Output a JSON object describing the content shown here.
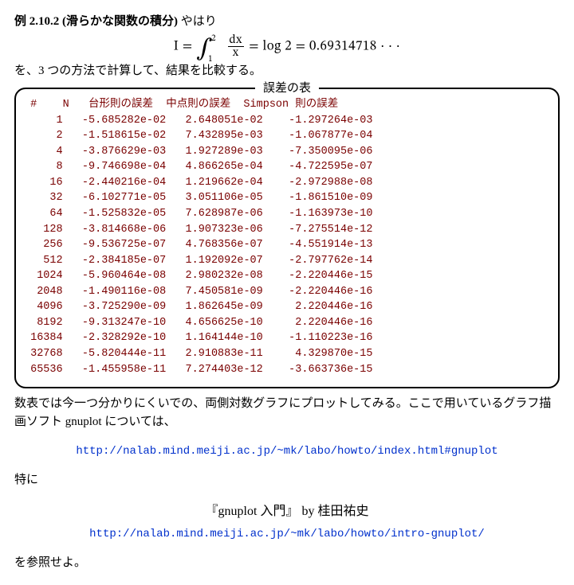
{
  "header": {
    "example_label": "例 2.10.2 (滑らかな関数の積分)",
    "after_label": " やはり",
    "equation_lhs": "I =",
    "integral_symbol": "∫",
    "int_lower": "1",
    "int_upper": "2",
    "frac_num": "dx",
    "frac_den": "x",
    "equation_rhs": " = log 2 = 0.69314718 · · ·",
    "line2": "を、3 つの方法で計算して、結果を比較する。"
  },
  "box": {
    "title": "誤差の表",
    "header_row": " #    N   台形則の誤差  中点則の誤差  Simpson 則の誤差",
    "rows": [
      "     1   -5.685282e-02   2.648051e-02    -1.297264e-03",
      "     2   -1.518615e-02   7.432895e-03    -1.067877e-04",
      "     4   -3.876629e-03   1.927289e-03    -7.350095e-06",
      "     8   -9.746698e-04   4.866265e-04    -4.722595e-07",
      "    16   -2.440216e-04   1.219662e-04    -2.972988e-08",
      "    32   -6.102771e-05   3.051106e-05    -1.861510e-09",
      "    64   -1.525832e-05   7.628987e-06    -1.163973e-10",
      "   128   -3.814668e-06   1.907323e-06    -7.275514e-12",
      "   256   -9.536725e-07   4.768356e-07    -4.551914e-13",
      "   512   -2.384185e-07   1.192092e-07    -2.797762e-14",
      "  1024   -5.960464e-08   2.980232e-08    -2.220446e-15",
      "  2048   -1.490116e-08   7.450581e-09    -2.220446e-16",
      "  4096   -3.725290e-09   1.862645e-09     2.220446e-16",
      "  8192   -9.313247e-10   4.656625e-10     2.220446e-16",
      " 16384   -2.328292e-10   1.164144e-10    -1.110223e-16",
      " 32768   -5.820444e-11   2.910883e-11     4.329870e-15",
      " 65536   -1.455958e-11   7.274403e-12    -3.663736e-15"
    ]
  },
  "body": {
    "after_table": "数表では今一つ分かりにくいでの、両側対数グラフにプロットしてみる。ここで用いているグラフ描画ソフト gnuplot については、",
    "link1": "http://nalab.mind.meiji.ac.jp/~mk/labo/howto/index.html#gnuplot",
    "tokuni": "特に",
    "credit": "『gnuplot 入門』 by 桂田祐史",
    "link2": "http://nalab.mind.meiji.ac.jp/~mk/labo/howto/intro-gnuplot/",
    "closing": "を参照せよ。"
  },
  "chart_data": {
    "type": "table",
    "title": "誤差の表",
    "columns": [
      "#",
      "N",
      "台形則の誤差",
      "中点則の誤差",
      "Simpson 則の誤差"
    ],
    "series": [
      {
        "name": "N",
        "values": [
          1,
          2,
          4,
          8,
          16,
          32,
          64,
          128,
          256,
          512,
          1024,
          2048,
          4096,
          8192,
          16384,
          32768,
          65536
        ]
      },
      {
        "name": "台形則の誤差",
        "values": [
          -0.05685282,
          -0.01518615,
          -0.003876629,
          -0.0009746698,
          -0.0002440216,
          -6.102771e-05,
          -1.525832e-05,
          -3.814668e-06,
          -9.536725e-07,
          -2.384185e-07,
          -5.960464e-08,
          -1.490116e-08,
          -3.72529e-09,
          -9.313247e-10,
          -2.328292e-10,
          -5.820444e-11,
          -1.455958e-11
        ]
      },
      {
        "name": "中点則の誤差",
        "values": [
          0.02648051,
          0.007432895,
          0.001927289,
          0.0004866265,
          0.0001219662,
          3.051106e-05,
          7.628987e-06,
          1.907323e-06,
          4.768356e-07,
          1.192092e-07,
          2.980232e-08,
          7.450581e-09,
          1.862645e-09,
          4.656625e-10,
          1.164144e-10,
          2.910883e-11,
          7.274403e-12
        ]
      },
      {
        "name": "Simpson 則の誤差",
        "values": [
          -0.001297264,
          -0.0001067877,
          -7.350095e-06,
          -4.722595e-07,
          -2.972988e-08,
          -1.86151e-09,
          -1.163973e-10,
          -7.275514e-12,
          -4.551914e-13,
          -2.797762e-14,
          -2.220446e-15,
          -2.220446e-16,
          2.220446e-16,
          2.220446e-16,
          -1.110223e-16,
          4.32987e-15,
          -3.663736e-15
        ]
      }
    ]
  }
}
